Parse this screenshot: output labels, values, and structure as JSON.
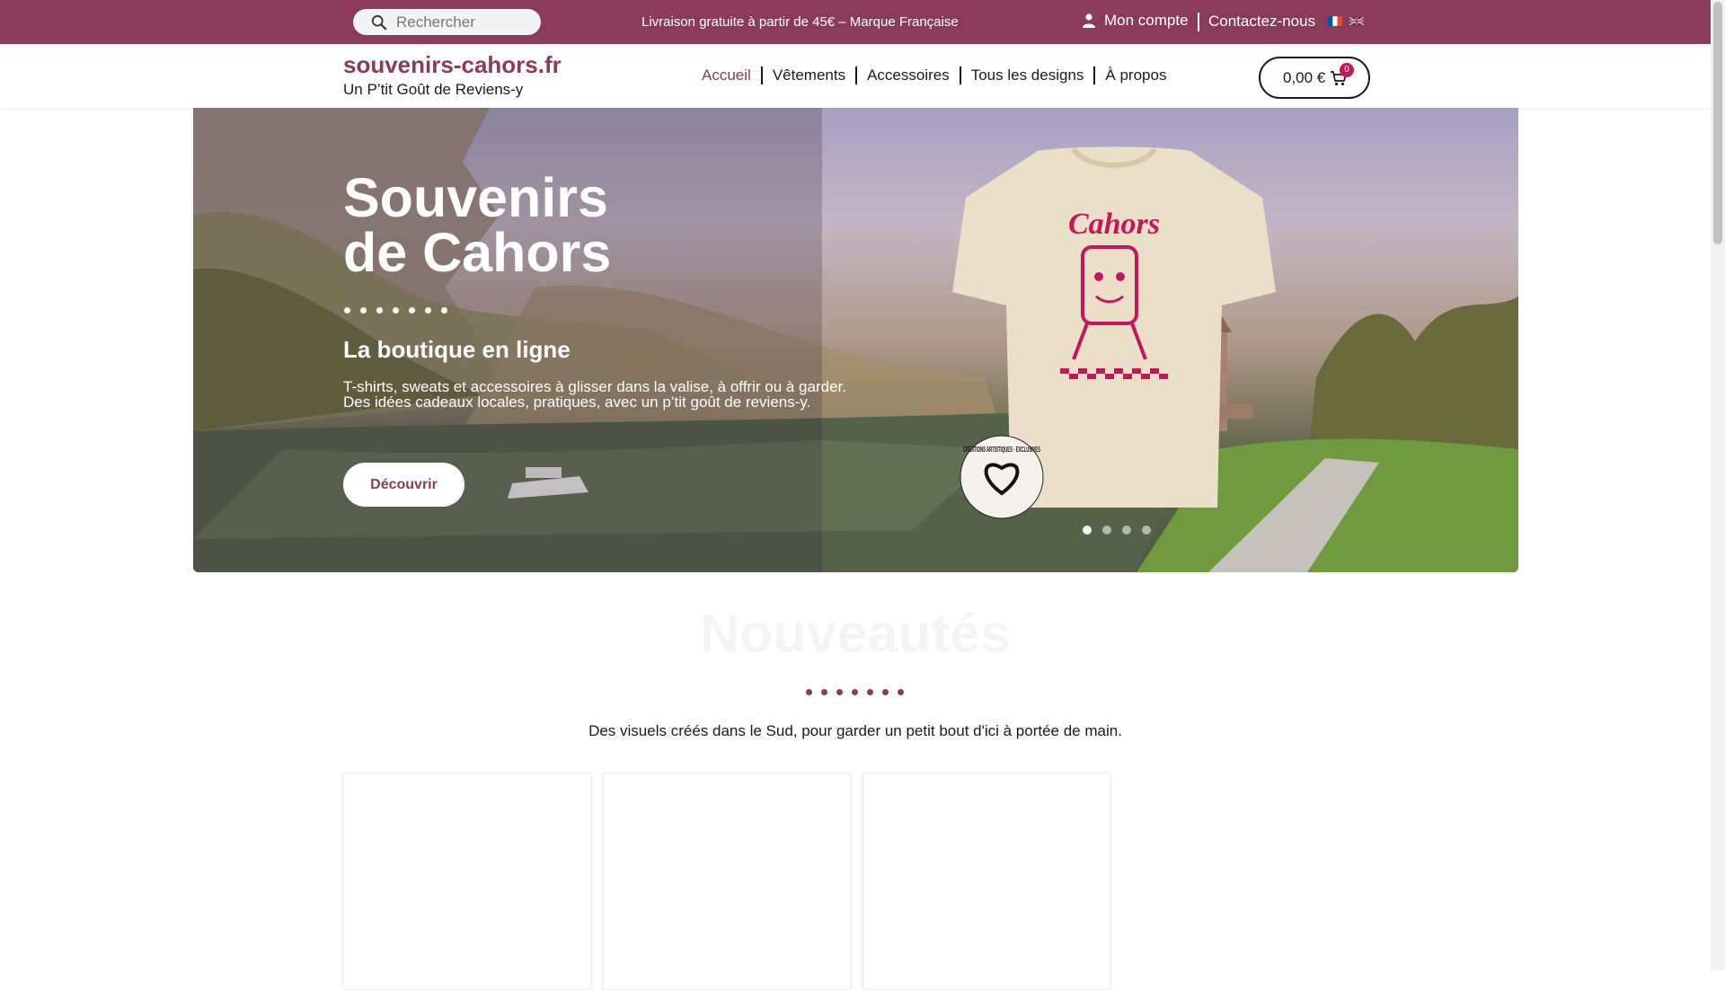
{
  "topbar": {
    "search_placeholder": "Rechercher",
    "promo": "Livraison gratuite à partir de 45€ – Marque Française",
    "account_label": "Mon compte",
    "contact_label": "Contactez-nous",
    "languages": [
      "fr",
      "en"
    ]
  },
  "header": {
    "site_title": "souvenirs-cahors.fr",
    "tagline": "Un P’tit Goût de Reviens-y",
    "nav": [
      "Accueil",
      "Vêtements",
      "Accessoires",
      "Tous les designs",
      "À propos"
    ],
    "active_nav": "Accueil",
    "cart_amount": "0,00 €",
    "cart_count": "0"
  },
  "hero": {
    "title_line1": "Souvenirs",
    "title_line2": "de Cahors",
    "subtitle": "La boutique en ligne",
    "desc_line1": "T-shirts, sweats et accessoires à glisser dans la valise, à offrir ou à garder.",
    "desc_line2": "Des idées cadeaux locales, pratiques, avec un p’tit goût de reviens-y.",
    "cta_label": "Découvrir",
    "shirt_print_text": "Cahors",
    "badge_text": "CRÉATIONS ARTISTIQUES · EXCLUSIVES",
    "slide_count": 4,
    "active_slide": 1
  },
  "section": {
    "title": "Nouveautés",
    "description": "Des visuels créés dans le Sud, pour garder un petit bout d'ici à portée de main."
  },
  "colors": {
    "brand": "#8c3a5a",
    "badge": "#c2185b"
  }
}
